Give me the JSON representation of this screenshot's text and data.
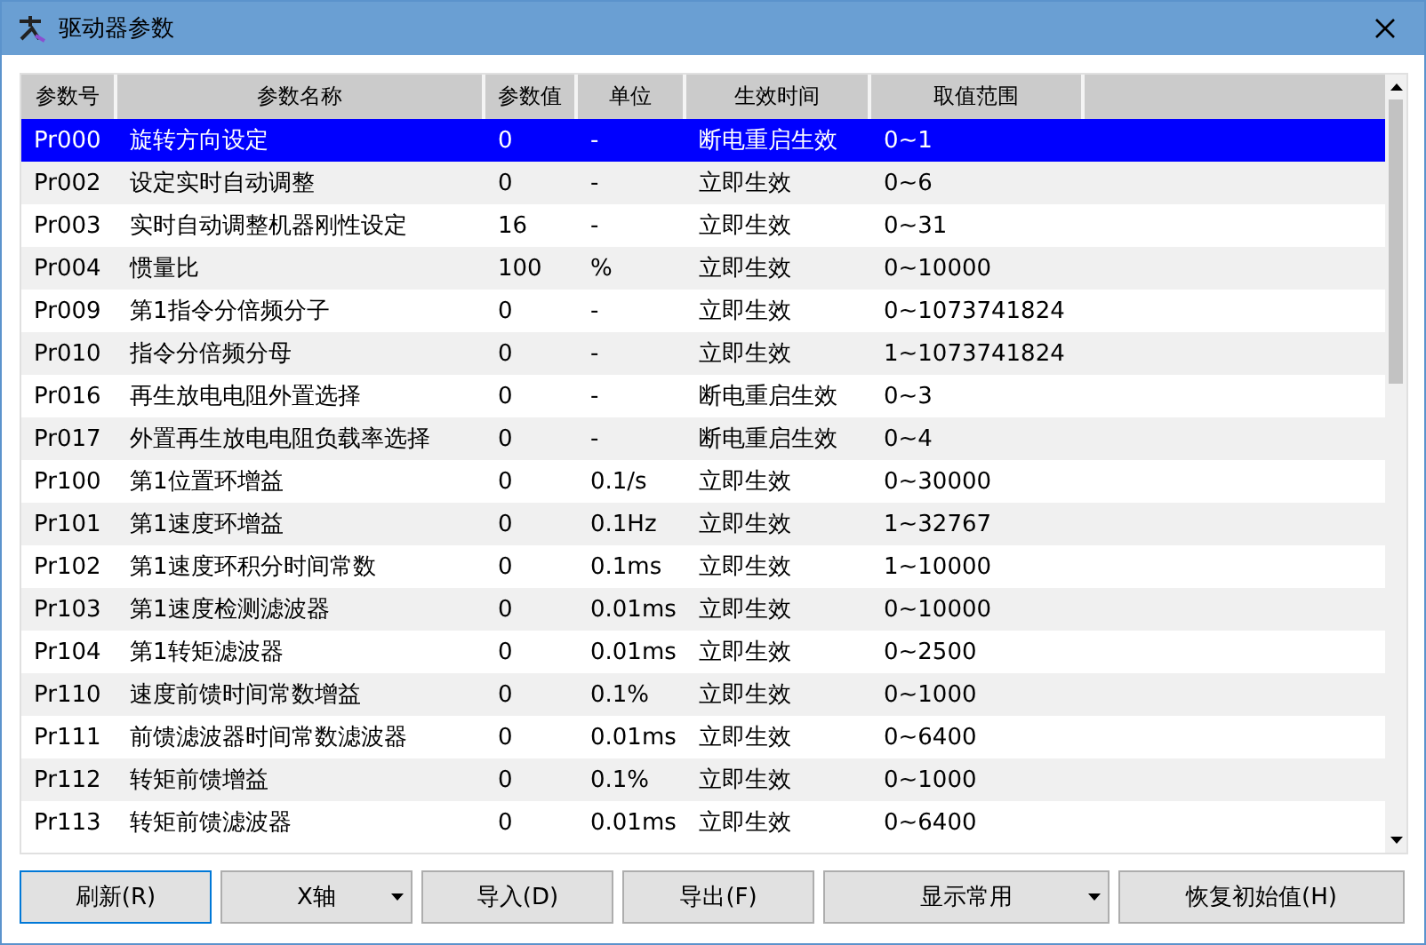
{
  "window": {
    "title": "驱动器参数"
  },
  "table": {
    "columns": [
      "参数号",
      "参数名称",
      "参数值",
      "单位",
      "生效时间",
      "取值范围"
    ],
    "rows": [
      {
        "cells": [
          "Pr000",
          "旋转方向设定",
          "0",
          "-",
          "断电重启生效",
          "0~1"
        ],
        "selected": true
      },
      {
        "cells": [
          "Pr002",
          "设定实时自动调整",
          "0",
          "-",
          "立即生效",
          "0~6"
        ],
        "selected": false
      },
      {
        "cells": [
          "Pr003",
          "实时自动调整机器刚性设定",
          "16",
          "-",
          "立即生效",
          "0~31"
        ],
        "selected": false
      },
      {
        "cells": [
          "Pr004",
          "惯量比",
          "100",
          "%",
          "立即生效",
          "0~10000"
        ],
        "selected": false
      },
      {
        "cells": [
          "Pr009",
          "第1指令分倍频分子",
          "0",
          "-",
          "立即生效",
          "0~1073741824"
        ],
        "selected": false
      },
      {
        "cells": [
          "Pr010",
          "指令分倍频分母",
          "0",
          "-",
          "立即生效",
          "1~1073741824"
        ],
        "selected": false
      },
      {
        "cells": [
          "Pr016",
          "再生放电电阻外置选择",
          "0",
          "-",
          "断电重启生效",
          "0~3"
        ],
        "selected": false
      },
      {
        "cells": [
          "Pr017",
          "外置再生放电电阻负载率选择",
          "0",
          "-",
          "断电重启生效",
          "0~4"
        ],
        "selected": false
      },
      {
        "cells": [
          "Pr100",
          "第1位置环增益",
          "0",
          "0.1/s",
          "立即生效",
          "0~30000"
        ],
        "selected": false
      },
      {
        "cells": [
          "Pr101",
          "第1速度环增益",
          "0",
          "0.1Hz",
          "立即生效",
          "1~32767"
        ],
        "selected": false
      },
      {
        "cells": [
          "Pr102",
          "第1速度环积分时间常数",
          "0",
          "0.1ms",
          "立即生效",
          "1~10000"
        ],
        "selected": false
      },
      {
        "cells": [
          "Pr103",
          "第1速度检测滤波器",
          "0",
          "0.01ms",
          "立即生效",
          "0~10000"
        ],
        "selected": false
      },
      {
        "cells": [
          "Pr104",
          "第1转矩滤波器",
          "0",
          "0.01ms",
          "立即生效",
          "0~2500"
        ],
        "selected": false
      },
      {
        "cells": [
          "Pr110",
          "速度前馈时间常数增益",
          "0",
          "0.1%",
          "立即生效",
          "0~1000"
        ],
        "selected": false
      },
      {
        "cells": [
          "Pr111",
          "前馈滤波器时间常数滤波器",
          "0",
          "0.01ms",
          "立即生效",
          "0~6400"
        ],
        "selected": false
      },
      {
        "cells": [
          "Pr112",
          "转矩前馈增益",
          "0",
          "0.1%",
          "立即生效",
          "0~1000"
        ],
        "selected": false
      },
      {
        "cells": [
          "Pr113",
          "转矩前馈滤波器",
          "0",
          "0.01ms",
          "立即生效",
          "0~6400"
        ],
        "selected": false
      }
    ]
  },
  "buttons": [
    {
      "label": "刷新(R)",
      "kind": "button"
    },
    {
      "label": "X轴",
      "kind": "dropdown"
    },
    {
      "label": "导入(D)",
      "kind": "button"
    },
    {
      "label": "导出(F)",
      "kind": "button"
    },
    {
      "label": "显示常用",
      "kind": "dropdown"
    },
    {
      "label": "恢复初始值(H)",
      "kind": "button"
    }
  ]
}
